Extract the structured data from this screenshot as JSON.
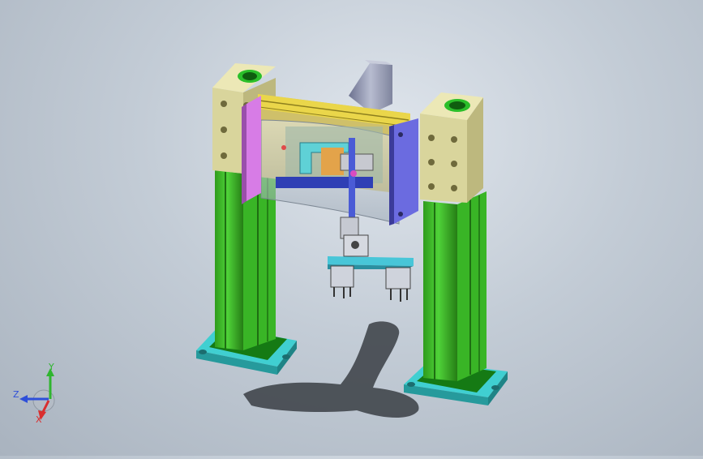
{
  "window": {
    "background_top": "#dfe5ec",
    "background_bottom": "#a9b3bf"
  },
  "colors": {
    "column_green": "#3fbf2a",
    "column_dark": "#1f7d14",
    "base_cyan": "#3dc7c9",
    "top_block": "#d9d49a",
    "side_plate_purple": "#6a6adf",
    "side_plate_pink": "#d77ce6",
    "rail_yellow": "#e8d24a",
    "actuator_grey": "#8a8fa6",
    "gripper_arm": "#48c6d8",
    "glass": "#c9d3dc"
  },
  "triad": {
    "y_label": "Y",
    "z_label": "Z",
    "x_label": "X",
    "y_color": "#2fb52f",
    "z_color": "#2e4fd9",
    "x_color": "#d92e2e"
  }
}
